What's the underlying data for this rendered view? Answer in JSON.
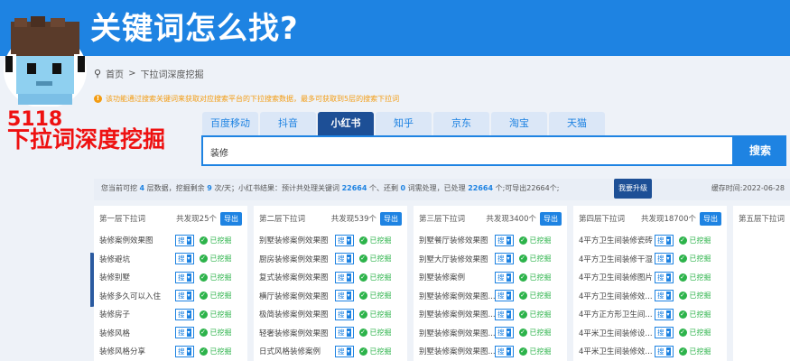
{
  "banner": {
    "title": "关键词怎么找?"
  },
  "overlay": {
    "brand": "5118",
    "subtitle": "下拉词深度挖掘"
  },
  "breadcrumb": {
    "home": "首页",
    "sep": ">",
    "current": "下拉词深度挖掘"
  },
  "notice": {
    "icon_text": "!",
    "text": "该功能通过搜索关键词来获取对应搜索平台的下拉搜索数据，最多可获取到5层的搜索下拉词"
  },
  "tabs": [
    {
      "label": "百度移动",
      "active": false
    },
    {
      "label": "抖音",
      "active": false
    },
    {
      "label": "小红书",
      "active": true
    },
    {
      "label": "知乎",
      "active": false
    },
    {
      "label": "京东",
      "active": false
    },
    {
      "label": "淘宝",
      "active": false
    },
    {
      "label": "天猫",
      "active": false
    }
  ],
  "search": {
    "value": "装修",
    "button": "搜索"
  },
  "stats": {
    "p1": "您当前可挖",
    "layers": "4",
    "p2": "层数据，挖掘剩余",
    "remain": "9",
    "p3": "次/天；小红书结果：预计共处理关键词",
    "total": "22664",
    "p4": "个、还剩",
    "left": "0",
    "p5": "词需处理，已处理",
    "done": "22664",
    "p6": "个;可导出22664个;",
    "upgrade": "我要升级",
    "cache": "缓存时间:2022-06-28"
  },
  "common": {
    "sou": "搜",
    "caret": "▾",
    "check": "✓",
    "mined": "已挖掘",
    "export": "导出"
  },
  "columns": [
    {
      "title": "第一层下拉词",
      "found": "共发现25个",
      "rows": [
        "装修案例效果图",
        "装修避坑",
        "装修别墅",
        "装修多久可以入住",
        "装修房子",
        "装修风格",
        "装修风格分享"
      ]
    },
    {
      "title": "第二层下拉词",
      "found": "共发现539个",
      "rows": [
        "别墅装修案例效果图",
        "厨房装修案例效果图",
        "复式装修案例效果图",
        "横厅装修案例效果图",
        "极简装修案例效果图",
        "轻奢装修案例效果图",
        "日式风格装修案例"
      ]
    },
    {
      "title": "第三层下拉词",
      "found": "共发现3400个",
      "rows": [
        "别墅餐厅装修效果图",
        "别墅大厅装修效果图",
        "别墅装修案例",
        "别墅装修案例效果图...",
        "别墅装修案例效果图...",
        "别墅装修案例效果图...",
        "别墅装修案例效果图..."
      ]
    },
    {
      "title": "第四层下拉词",
      "found": "共发现18700个",
      "rows": [
        "4平方卫生间装修瓷砖",
        "4平方卫生间装修干湿",
        "4平方卫生间装修图片",
        "4平方卫生间装修效...",
        "4平方正方形卫生间...",
        "4平米卫生间装修设...",
        "4平米卫生间装修效..."
      ]
    },
    {
      "title": "第五层下拉词",
      "found": "",
      "rows": []
    }
  ]
}
